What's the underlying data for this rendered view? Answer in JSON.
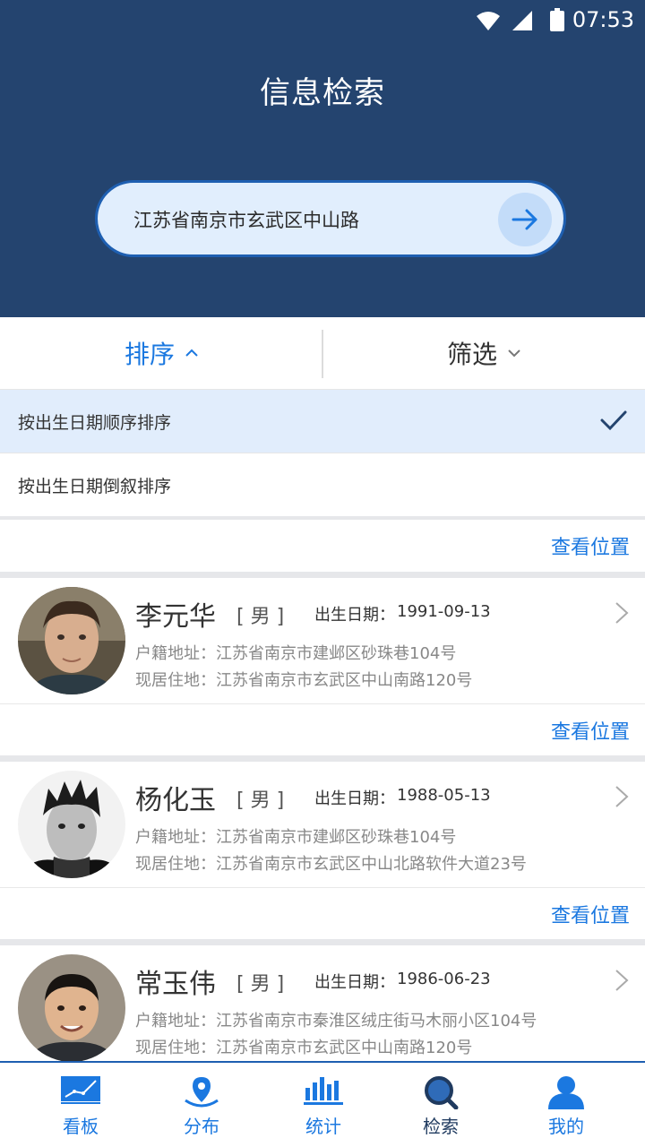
{
  "status_bar": {
    "time": "07:53"
  },
  "header": {
    "title": "信息检索"
  },
  "search": {
    "value": "江苏省南京市玄武区中山路"
  },
  "tabs": {
    "sort_label": "排序",
    "filter_label": "筛选"
  },
  "sort_options": [
    {
      "label": "按出生日期顺序排序",
      "selected": true
    },
    {
      "label": "按出生日期倒叙排序",
      "selected": false
    }
  ],
  "view_location_label": "查看位置",
  "field_labels": {
    "birth": "出生日期：",
    "hukou": "户籍地址：",
    "residence": "现居住地："
  },
  "people": [
    {
      "name": "李元华",
      "gender": "[ 男 ]",
      "birth": "1991-09-13",
      "hukou": "江苏省南京市建邺区砂珠巷104号",
      "residence": "江苏省南京市玄武区中山南路120号"
    },
    {
      "name": "杨化玉",
      "gender": "[ 男 ]",
      "birth": "1988-05-13",
      "hukou": "江苏省南京市建邺区砂珠巷104号",
      "residence": "江苏省南京市玄武区中山北路软件大道23号"
    },
    {
      "name": "常玉伟",
      "gender": "[ 男 ]",
      "birth": "1986-06-23",
      "hukou": "江苏省南京市秦淮区绒庄街马木丽小区104号",
      "residence": "江苏省南京市玄武区中山南路120号"
    }
  ],
  "bottom_nav": [
    {
      "label": "看板",
      "icon": "dashboard-icon"
    },
    {
      "label": "分布",
      "icon": "location-pin-icon"
    },
    {
      "label": "统计",
      "icon": "bar-chart-icon"
    },
    {
      "label": "检索",
      "icon": "search-icon",
      "active": true
    },
    {
      "label": "我的",
      "icon": "user-icon"
    }
  ],
  "colors": {
    "header_bg": "#24446f",
    "accent": "#1b78e0",
    "selected_bg": "#e1edfc"
  }
}
